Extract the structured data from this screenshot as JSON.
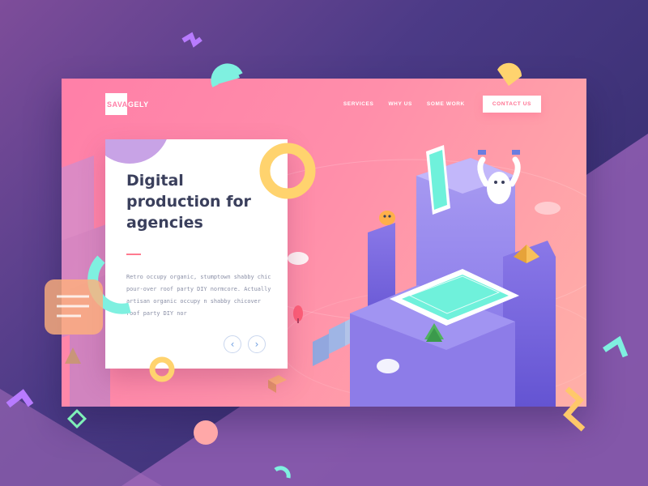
{
  "brand": {
    "logo_boxed": "SAVA",
    "logo_rest": "GELY"
  },
  "nav": {
    "items": [
      "SERVICES",
      "WHY US",
      "SOME WORK"
    ],
    "cta": "CONTACT US"
  },
  "hero": {
    "title": "Digital production for agencies",
    "body": "Retro occupy organic, stumptown shabby chic pour-over roof party DIY normcore. Actually artisan organic occupy n shabby chicover roof party DIY nor",
    "prev_icon": "chevron-left-icon",
    "next_icon": "chevron-right-icon"
  },
  "colors": {
    "accent_pink": "#ff7fa8",
    "cta_text": "#ff7191",
    "title_text": "#3a3f5c",
    "yellow": "#ffd36e",
    "cyan": "#7ff0e0",
    "purple": "#9b6ae0"
  }
}
